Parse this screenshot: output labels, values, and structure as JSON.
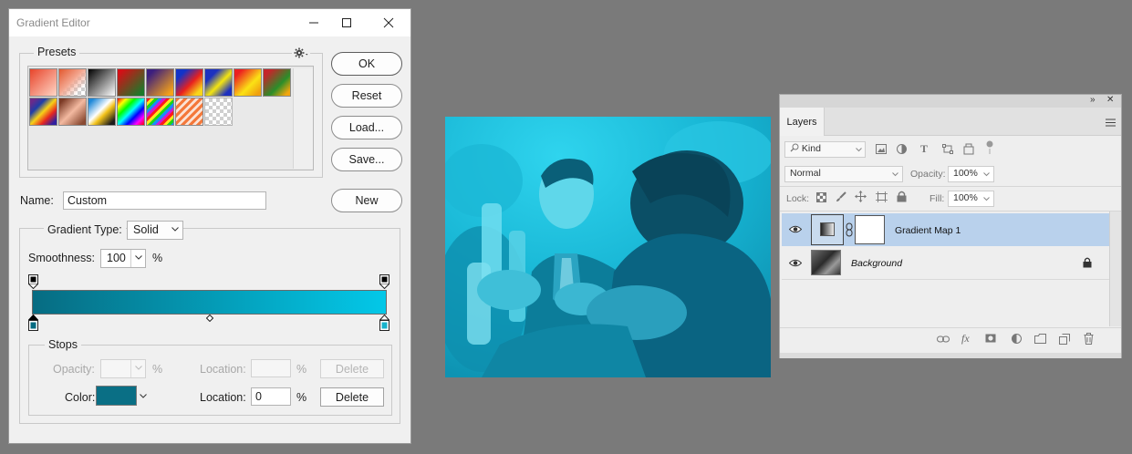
{
  "gradient_editor": {
    "title": "Gradient Editor",
    "presets_label": "Presets",
    "buttons": {
      "ok": "OK",
      "reset": "Reset",
      "load": "Load...",
      "save": "Save...",
      "new": "New"
    },
    "name_label": "Name:",
    "name_value": "Custom",
    "gradient_type_label": "Gradient Type:",
    "gradient_type_value": "Solid",
    "smoothness_label": "Smoothness:",
    "smoothness_value": "100",
    "percent": "%",
    "gradient_colors": {
      "start": "#066c82",
      "end": "#03c8e8"
    },
    "stops": {
      "label": "Stops",
      "opacity_label": "Opacity:",
      "opacity_value": "",
      "location_label": "Location:",
      "opacity_location_value": "",
      "delete_label": "Delete",
      "color_label": "Color:",
      "color_value": "#0a6f85",
      "color_location_value": "0"
    }
  },
  "layers_panel": {
    "tab": "Layers",
    "kind_label": "Kind",
    "blend_mode": "Normal",
    "opacity_label": "Opacity:",
    "opacity_value": "100%",
    "lock_label": "Lock:",
    "fill_label": "Fill:",
    "fill_value": "100%",
    "layers": [
      {
        "name": "Gradient Map 1",
        "selected": true
      },
      {
        "name": "Background",
        "italic": true,
        "locked": true
      }
    ]
  }
}
